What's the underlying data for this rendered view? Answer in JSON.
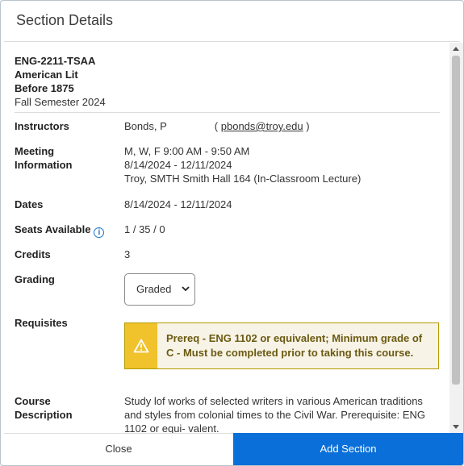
{
  "dialog": {
    "title": "Section Details"
  },
  "course": {
    "code": "ENG-2211-TSAA",
    "title_line1": "American Lit",
    "title_line2": "Before 1875",
    "term": "Fall Semester 2024"
  },
  "fields": {
    "instructors": {
      "label": "Instructors",
      "name": "Bonds, P",
      "open_paren": "(",
      "email": "pbonds@troy.edu",
      "close_paren": ")"
    },
    "meeting": {
      "label_line1": "Meeting",
      "label_line2": "Information",
      "line1": "M, W, F 9:00 AM - 9:50 AM",
      "line2": "8/14/2024 - 12/11/2024",
      "line3": "Troy, SMTH Smith Hall 164 (In-Classroom Lecture)"
    },
    "dates": {
      "label": "Dates",
      "value": "8/14/2024 - 12/11/2024"
    },
    "seats": {
      "label": "Seats Available",
      "icon_glyph": "i",
      "value": "1 / 35 / 0"
    },
    "credits": {
      "label": "Credits",
      "value": "3"
    },
    "grading": {
      "label": "Grading",
      "selected": "Graded"
    },
    "requisites": {
      "label": "Requisites",
      "text": "Prereq - ENG 1102 or equivalent; Minimum grade of C - Must be completed prior to taking this course."
    },
    "description": {
      "label_line1": "Course",
      "label_line2": "Description",
      "text": "Study lof works of selected writers in various American traditions and styles from colonial times to the Civil War. Prerequisite: ENG 1102 or equi- valent."
    }
  },
  "footer": {
    "close_label": "Close",
    "add_label": "Add Section"
  },
  "colors": {
    "primary": "#0a6fd8",
    "warning": "#f0c22b",
    "warning_bg": "#f7f3e6",
    "warning_text": "#6b5a12",
    "info": "#1a73c9"
  },
  "icons": {
    "seats_info": "info-icon",
    "requisite_alert": "warning-icon",
    "grading_dropdown": "chevron-down-icon"
  }
}
